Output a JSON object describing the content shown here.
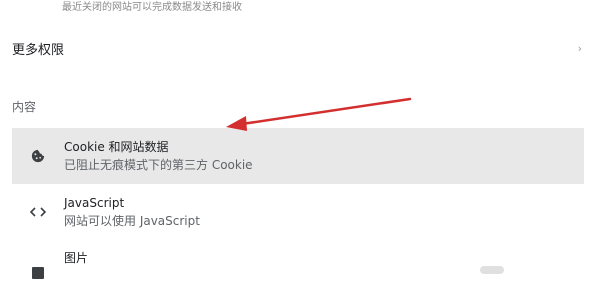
{
  "top_clipped_text": "最近关闭的网站可以完成数据发送和接收",
  "more_permissions": {
    "label": "更多权限"
  },
  "content_section": {
    "heading": "内容"
  },
  "items": [
    {
      "title": "Cookie 和网站数据",
      "subtitle": "已阻止无痕模式下的第三方 Cookie",
      "icon": "cookie-icon"
    },
    {
      "title": "JavaScript",
      "subtitle": "网站可以使用 JavaScript",
      "icon": "code-icon"
    },
    {
      "title": "图片",
      "subtitle": "",
      "icon": "image-icon"
    }
  ],
  "colors": {
    "highlight": "#e8e8e8",
    "annotation_arrow": "#d32f2f"
  }
}
